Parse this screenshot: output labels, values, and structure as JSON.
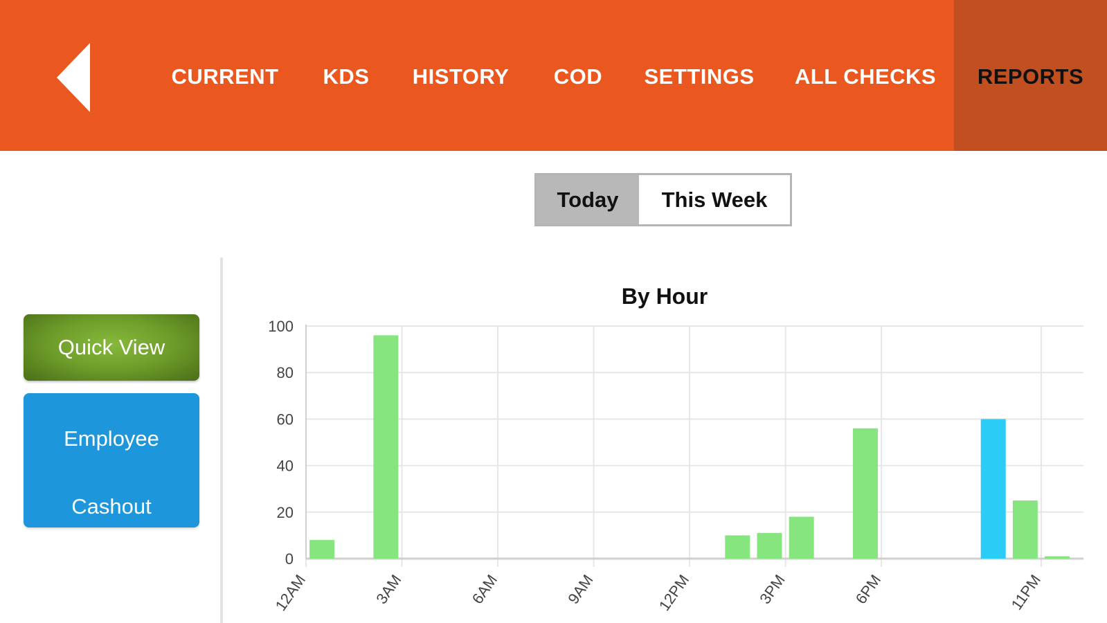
{
  "nav": {
    "items": [
      {
        "id": "current",
        "label": "CURRENT",
        "active": false
      },
      {
        "id": "kds",
        "label": "KDS",
        "active": false
      },
      {
        "id": "history",
        "label": "HISTORY",
        "active": false
      },
      {
        "id": "cod",
        "label": "COD",
        "active": false
      },
      {
        "id": "settings",
        "label": "SETTINGS",
        "active": false
      },
      {
        "id": "allchecks",
        "label": "ALL CHECKS",
        "active": false
      },
      {
        "id": "reports",
        "label": "REPORTS",
        "active": true
      }
    ],
    "back_icon": "back-arrow-icon"
  },
  "period_toggle": {
    "options": [
      "Today",
      "This Week"
    ],
    "selected": "Today"
  },
  "sidebar": {
    "quick_view_label": "Quick View",
    "cashout_line1": "Employee",
    "cashout_line2": "Cashout"
  },
  "colors": {
    "header": "#ea581f",
    "active_tab": "#c14f20",
    "bar_default": "#86e57f",
    "bar_highlight": "#2bcdf7",
    "quick_view": "#6e9c2a",
    "cashout": "#1e96db"
  },
  "chart_data": {
    "type": "bar",
    "title": "By Hour",
    "xlabel": "",
    "ylabel": "",
    "ylim": [
      0,
      100
    ],
    "yticks": [
      0,
      20,
      40,
      60,
      80,
      100
    ],
    "grid": true,
    "hours": 24,
    "x_tick_labels": [
      {
        "hour": 0,
        "label": "12AM"
      },
      {
        "hour": 3,
        "label": "3AM"
      },
      {
        "hour": 6,
        "label": "6AM"
      },
      {
        "hour": 9,
        "label": "9AM"
      },
      {
        "hour": 12,
        "label": "12PM"
      },
      {
        "hour": 15,
        "label": "3PM"
      },
      {
        "hour": 18,
        "label": "6PM"
      },
      {
        "hour": 23,
        "label": "11PM"
      }
    ],
    "bars": [
      {
        "hour": 0,
        "value": 8,
        "highlight": false
      },
      {
        "hour": 2,
        "value": 96,
        "highlight": false
      },
      {
        "hour": 13,
        "value": 10,
        "highlight": false
      },
      {
        "hour": 14,
        "value": 11,
        "highlight": false
      },
      {
        "hour": 15,
        "value": 18,
        "highlight": false
      },
      {
        "hour": 17,
        "value": 56,
        "highlight": false
      },
      {
        "hour": 21,
        "value": 60,
        "highlight": true
      },
      {
        "hour": 22,
        "value": 25,
        "highlight": false
      },
      {
        "hour": 23,
        "value": 1,
        "highlight": false
      }
    ]
  }
}
